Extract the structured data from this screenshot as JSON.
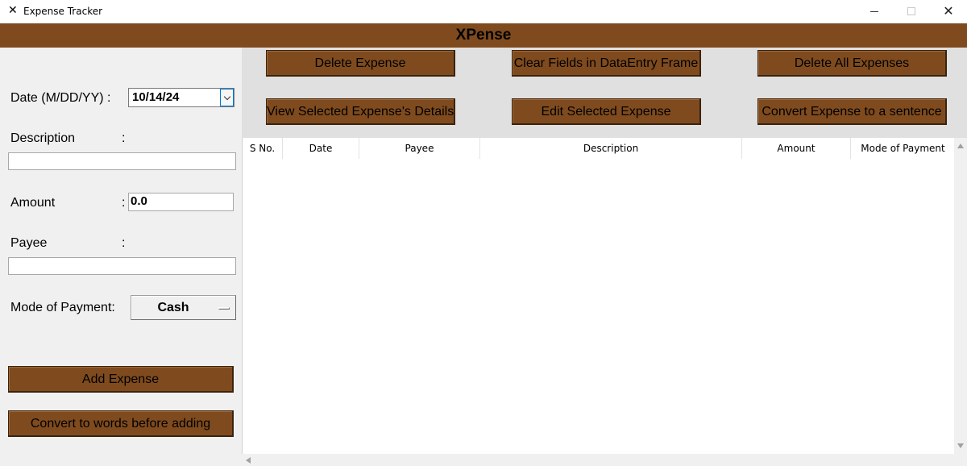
{
  "window": {
    "title": "Expense Tracker",
    "app_icon_glyph": "✕",
    "minimize_glyph": "",
    "close_glyph": "✕"
  },
  "header": {
    "title": "XPense"
  },
  "form": {
    "date": {
      "label": "Date (M/DD/YY) :",
      "value": "10/14/24"
    },
    "description": {
      "label": "Description",
      "colon": ":",
      "value": ""
    },
    "amount": {
      "label": "Amount",
      "colon": ":",
      "value": "0.0"
    },
    "payee": {
      "label": "Payee",
      "colon": ":",
      "value": ""
    },
    "mode_of_payment": {
      "label": "Mode of Payment:",
      "value": "Cash"
    },
    "add_button": "Add Expense",
    "convert_button": "Convert to words before adding"
  },
  "actions": {
    "delete_expense": "Delete Expense",
    "clear_fields": "Clear Fields in DataEntry Frame",
    "delete_all": "Delete All Expenses",
    "view_details": "View Selected Expense's Details",
    "edit_selected": "Edit Selected Expense",
    "convert_sentence": "Convert Expense to a sentence"
  },
  "table": {
    "columns": [
      "S No.",
      "Date",
      "Payee",
      "Description",
      "Amount",
      "Mode of Payment"
    ],
    "rows": []
  },
  "colors": {
    "brand_brown": "#7f4b1e",
    "panel_gray": "#e0e0e0",
    "window_bg": "#f0f0f0"
  },
  "icons": {
    "app": "x-logo-icon",
    "date_dropdown": "chevron-down-icon",
    "scroll_up": "arrow-up-icon",
    "scroll_down": "arrow-down-icon",
    "scroll_left": "arrow-left-icon"
  }
}
